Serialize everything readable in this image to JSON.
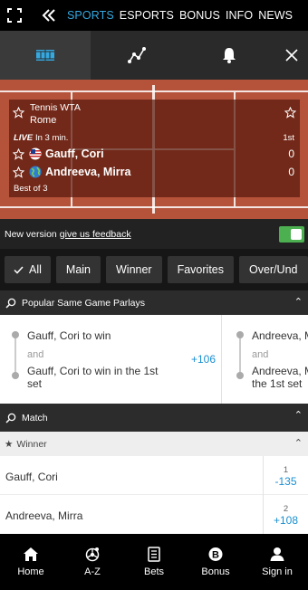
{
  "nav": {
    "items": [
      {
        "label": "SPORTS",
        "active": true
      },
      {
        "label": "ESPORTS",
        "active": false
      },
      {
        "label": "BONUS",
        "active": false
      },
      {
        "label": "INFO",
        "active": false
      },
      {
        "label": "NEWS",
        "active": false
      }
    ],
    "accent_color": "#35a8e0"
  },
  "event_tabs": {
    "icons": [
      "court-icon",
      "stats-icon",
      "bell-icon",
      "close-icon"
    ]
  },
  "match": {
    "tournament": "Tennis WTA",
    "location": "Rome",
    "live_label": "LIVE",
    "start_text": "In 3 min.",
    "set_label": "1st",
    "players": [
      {
        "name": "Gauff, Cori",
        "flag": "us-flag-icon",
        "score": "0"
      },
      {
        "name": "Andreeva, Mirra",
        "flag": "globe-icon",
        "score": "0"
      }
    ],
    "format": "Best of 3"
  },
  "feedback": {
    "text": "New version",
    "link": "give us feedback",
    "toggle_on": true
  },
  "filters": [
    "All",
    "Main",
    "Winner",
    "Favorites",
    "Over/Und"
  ],
  "sections": {
    "parlays_title": "Popular Same Game Parlays",
    "match_title": "Match",
    "winner_title": "Winner"
  },
  "parlays": [
    {
      "leg1": "Gauff, Cori to win",
      "and": "and",
      "leg2a": "Gauff, Cori to win in the 1st",
      "leg2b": "set",
      "odds": "+106"
    },
    {
      "leg1": "Andreeva, M",
      "and": "and",
      "leg2a": "Andreeva, M",
      "leg2b": "the 1st set"
    }
  ],
  "winner": [
    {
      "name": "Gauff, Cori",
      "num": "1",
      "odds": "-135"
    },
    {
      "name": "Andreeva, Mirra",
      "num": "2",
      "odds": "+108"
    }
  ],
  "bottom_nav": [
    {
      "label": "Home",
      "icon": "home-icon"
    },
    {
      "label": "A-Z",
      "icon": "az-icon"
    },
    {
      "label": "Bets",
      "icon": "bets-icon"
    },
    {
      "label": "Bonus",
      "icon": "bonus-icon"
    },
    {
      "label": "Sign in",
      "icon": "user-icon"
    }
  ]
}
